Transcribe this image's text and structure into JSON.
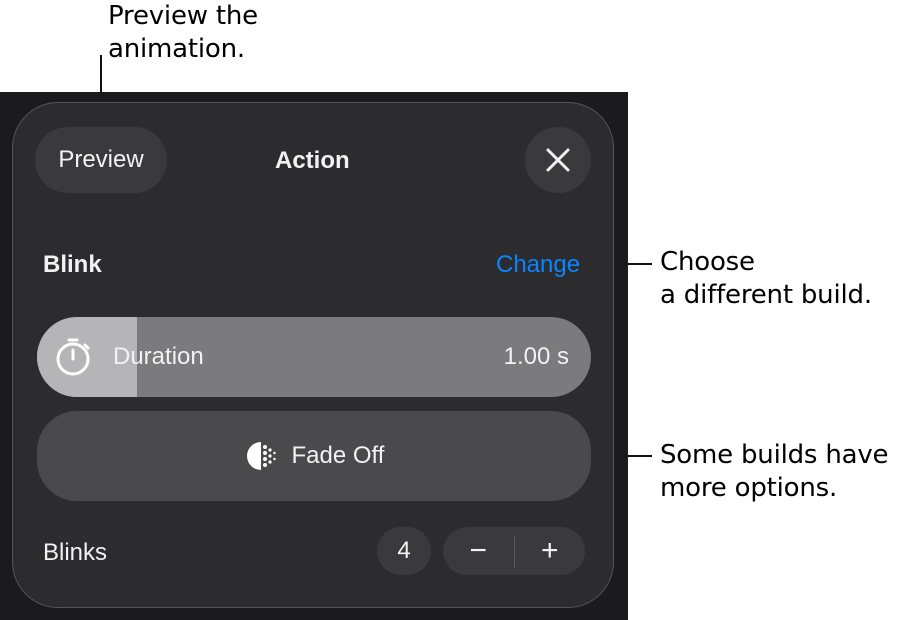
{
  "callouts": {
    "preview_line1": "Preview the",
    "preview_line2": "animation.",
    "change_line1": "Choose",
    "change_line2": "a different build.",
    "options_line1": "Some builds have",
    "options_line2": "more options."
  },
  "header": {
    "preview_label": "Preview",
    "title": "Action",
    "close_icon": "close-icon"
  },
  "build": {
    "name": "Blink",
    "change_label": "Change"
  },
  "duration": {
    "label": "Duration",
    "value": "1.00 s",
    "icon": "stopwatch-icon",
    "fill_fraction": 0.18
  },
  "fade": {
    "label": "Fade Off",
    "icon": "fade-dots-icon"
  },
  "blinks": {
    "label": "Blinks",
    "count": "4",
    "minus": "−",
    "plus": "+"
  },
  "colors": {
    "accent": "#0a84ff",
    "panel": "#2c2c2e",
    "background": "#1b1b1d"
  }
}
